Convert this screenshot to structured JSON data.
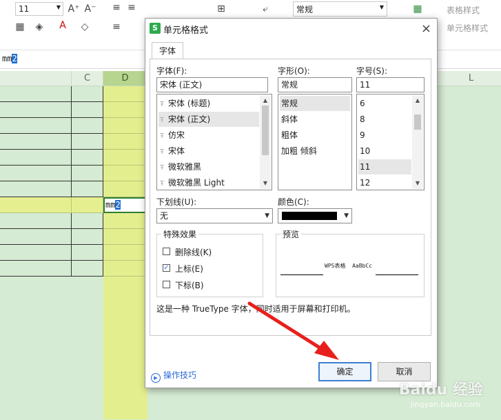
{
  "ribbon": {
    "font_size": "11",
    "number_format": "常规",
    "table_style": "表格样式",
    "cell_style": "单元格样式"
  },
  "formula_bar": {
    "text_before": "mm",
    "text_selected": "2"
  },
  "sheet": {
    "columns": [
      "C",
      "D",
      "L"
    ],
    "active_cell": {
      "text_before": "mm",
      "text_super": "2"
    }
  },
  "dialog": {
    "title": "单元格格式",
    "tab": "字体",
    "font": {
      "label": "字体(F):",
      "value": "宋体 (正文)",
      "items": [
        "宋体 (标题)",
        "宋体 (正文)",
        "仿宋",
        "宋体",
        "微软雅黑",
        "微软雅黑 Light"
      ],
      "selected_index": 1
    },
    "style": {
      "label": "字形(O):",
      "value": "常规",
      "items": [
        "常规",
        "斜体",
        "粗体",
        "加粗 倾斜"
      ],
      "selected_index": 0
    },
    "size": {
      "label": "字号(S):",
      "value": "11",
      "items": [
        "6",
        "8",
        "9",
        "10",
        "11",
        "12"
      ],
      "selected_index": 4
    },
    "underline": {
      "label": "下划线(U):",
      "value": "无"
    },
    "color": {
      "label": "颜色(C):",
      "value": "#000000"
    },
    "effects": {
      "title": "特殊效果",
      "strikethrough": {
        "label": "删除线(K)",
        "checked": false
      },
      "superscript": {
        "label": "上标(E)",
        "checked": true
      },
      "subscript": {
        "label": "下标(B)",
        "checked": false
      }
    },
    "preview": {
      "title": "预览",
      "sample": "WPS表格  AaBbCc"
    },
    "description": "这是一种 TrueType 字体，同时适用于屏幕和打印机。",
    "tips": "操作技巧",
    "ok": "确定",
    "cancel": "取消",
    "close": "×"
  },
  "watermark": {
    "main": "Baidu 经验",
    "sub": "jingyan.baidu.com"
  }
}
